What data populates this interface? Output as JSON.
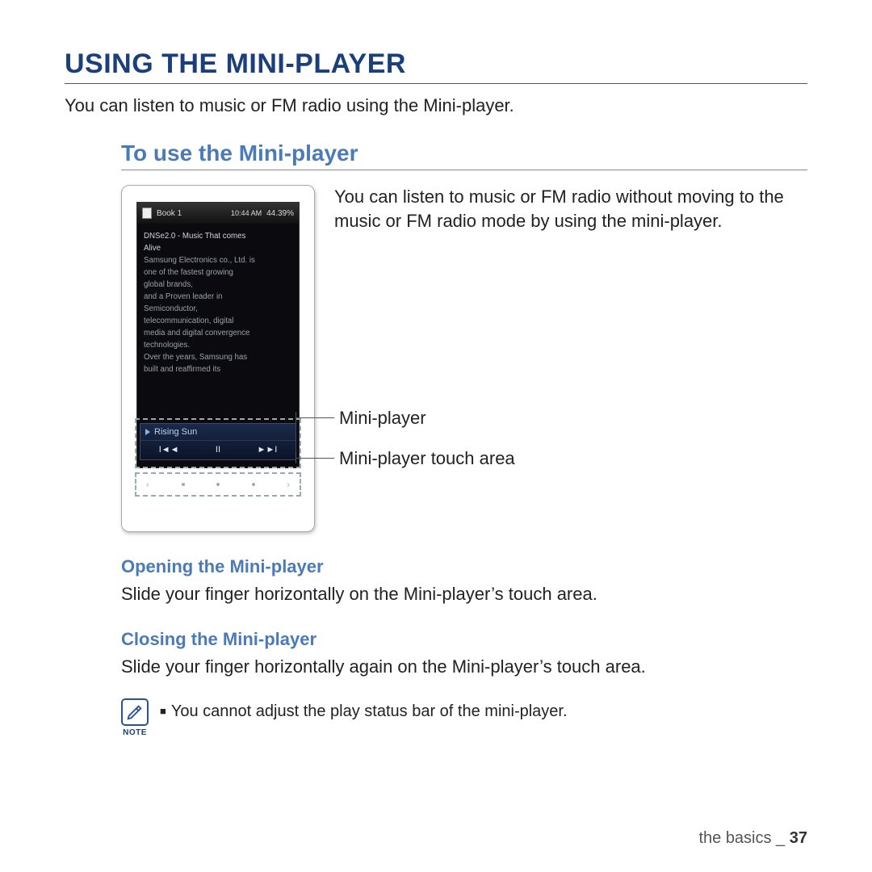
{
  "title": "USING THE MINI-PLAYER",
  "intro": "You can listen to music or FM radio using the Mini-player.",
  "section_title": "To use the Mini-player",
  "description": "You can listen to music or FM radio without moving to the music or FM radio mode by using the mini-player.",
  "callout1": "Mini-player",
  "callout2": "Mini-player touch area",
  "device": {
    "status_title": "Book 1",
    "status_time": "10:44 AM",
    "status_pct": "44.39%",
    "text_line1": "DNSe2.0 - Music That comes",
    "text_line2": "Alive",
    "text_line3": "Samsung Electronics co., Ltd. is",
    "text_line4": "one of the fastest growing",
    "text_line5": "global brands,",
    "text_line6": "and a Proven leader in",
    "text_line7": "Semiconductor,",
    "text_line8": "telecommunication, digital",
    "text_line9": "media and digital convergence",
    "text_line10": "technologies.",
    "text_line11": "Over the years, Samsung has",
    "text_line12": "built and reaffirmed its",
    "mp_track": "Rising Sun",
    "mp_prev": "І◄◄",
    "mp_play": "ІІ",
    "mp_next": "►►І",
    "touch_left": "‹",
    "touch_right": "›"
  },
  "opening": {
    "title": "Opening the Mini-player",
    "body": "Slide your finger horizontally on the Mini-player’s touch area."
  },
  "closing": {
    "title": "Closing the Mini-player",
    "body": "Slide your finger horizontally again on the Mini-player’s touch area."
  },
  "note": {
    "label": "NOTE",
    "text": "You cannot adjust the play status bar of the mini-player."
  },
  "footer": {
    "section": "the basics _",
    "page": "37"
  }
}
